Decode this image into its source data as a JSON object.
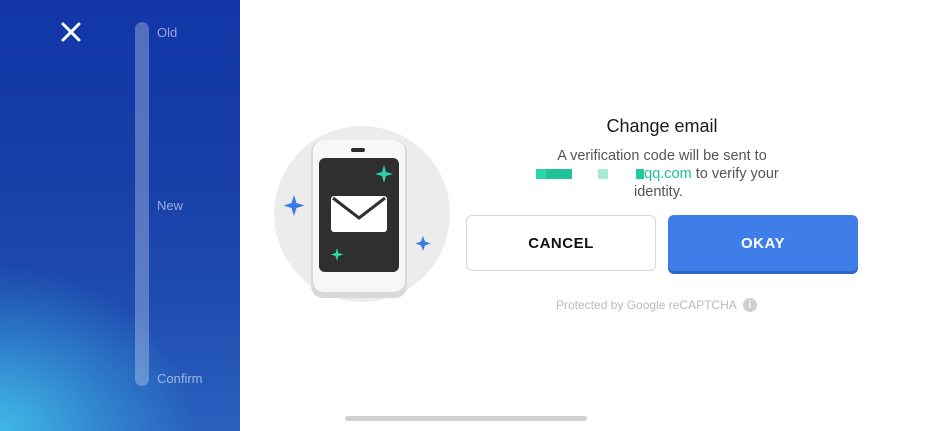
{
  "close_icon": "close-icon",
  "steps": {
    "old": "Old",
    "new": "New",
    "confirm": "Confirm"
  },
  "dialog": {
    "title": "Change email",
    "message_line1": "A verification code will be sent to",
    "email_domain": "qq.com",
    "message_line2_suffix": " to verify your",
    "message_line3": "identity.",
    "cancel_label": "CANCEL",
    "okay_label": "OKAY"
  },
  "recaptcha": {
    "text": "Protected by Google reCAPTCHA",
    "info_icon": "info-icon"
  },
  "colors": {
    "accent_blue": "#3f7ee8",
    "email_green": "#1dbf99",
    "panel_blue": "#173ea8"
  }
}
